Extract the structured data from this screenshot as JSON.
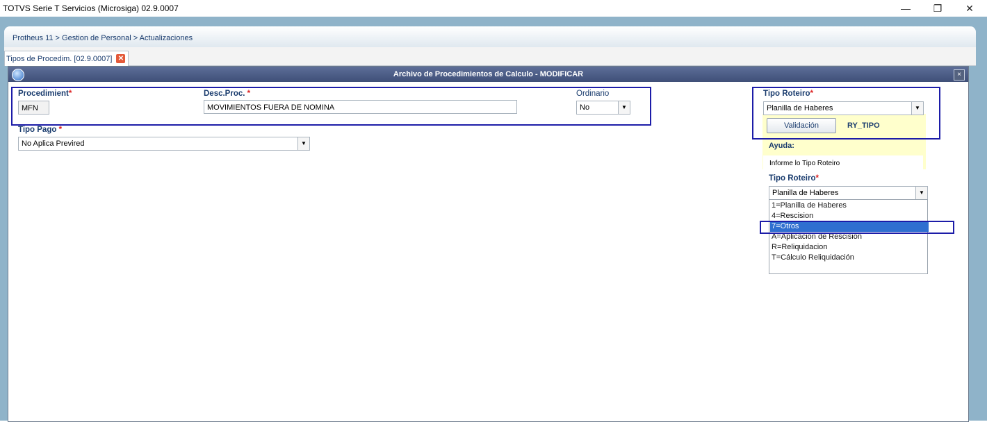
{
  "window": {
    "title": "TOTVS Serie T Servicios (Microsiga) 02.9.0007",
    "minimize": "—",
    "restore": "❐",
    "close": "✕"
  },
  "breadcrumb": "Protheus 11 > Gestion de Personal > Actualizaciones",
  "tab": {
    "label": "Tipos de Procedim. [02.9.0007]",
    "close": "✕"
  },
  "dialog": {
    "title": "Archivo de Procedimientos de Calculo - MODIFICAR",
    "close": "×"
  },
  "form": {
    "procedimiento": {
      "label": "Procedimient",
      "required": "*",
      "value": "MFN"
    },
    "desc_proc": {
      "label": "Desc.Proc. ",
      "required": "*",
      "value": "MOVIMIENTOS FUERA DE NOMINA"
    },
    "ordinario": {
      "label": "Ordinario",
      "value": "No"
    },
    "tipo_pago": {
      "label": "Tipo Pago ",
      "required": "*",
      "value": "No Aplica Previred"
    },
    "tipo_roteiro": {
      "label": "Tipo Roteiro",
      "required": "*",
      "value": "Planilla de Haberes"
    }
  },
  "help_panel": {
    "validation_button": "Validación",
    "field_id": "RY_TIPO",
    "help_title": "Ayuda:",
    "help_text": "Informe lo Tipo Roteiro"
  },
  "dropdown": {
    "label": "Tipo Roteiro",
    "required": "*",
    "value": "Planilla de Haberes",
    "options": [
      "1=Planilla de Haberes",
      "4=Rescision",
      "7=Otros",
      "A=Aplicacion de Rescision",
      "R=Reliquidacion",
      "T=Cálculo Reliquidación"
    ],
    "selected_index": 2
  },
  "colors": {
    "accent_blue": "#1a3c6e",
    "highlight_border": "#1c1ca8",
    "selection": "#2f6fd0",
    "help_background": "#ffffcc",
    "required": "#d22222"
  },
  "icons": {
    "dialog_logo": "totvs-logo-icon",
    "dropdown_arrow": "chevron-down-icon",
    "close": "close-icon"
  }
}
